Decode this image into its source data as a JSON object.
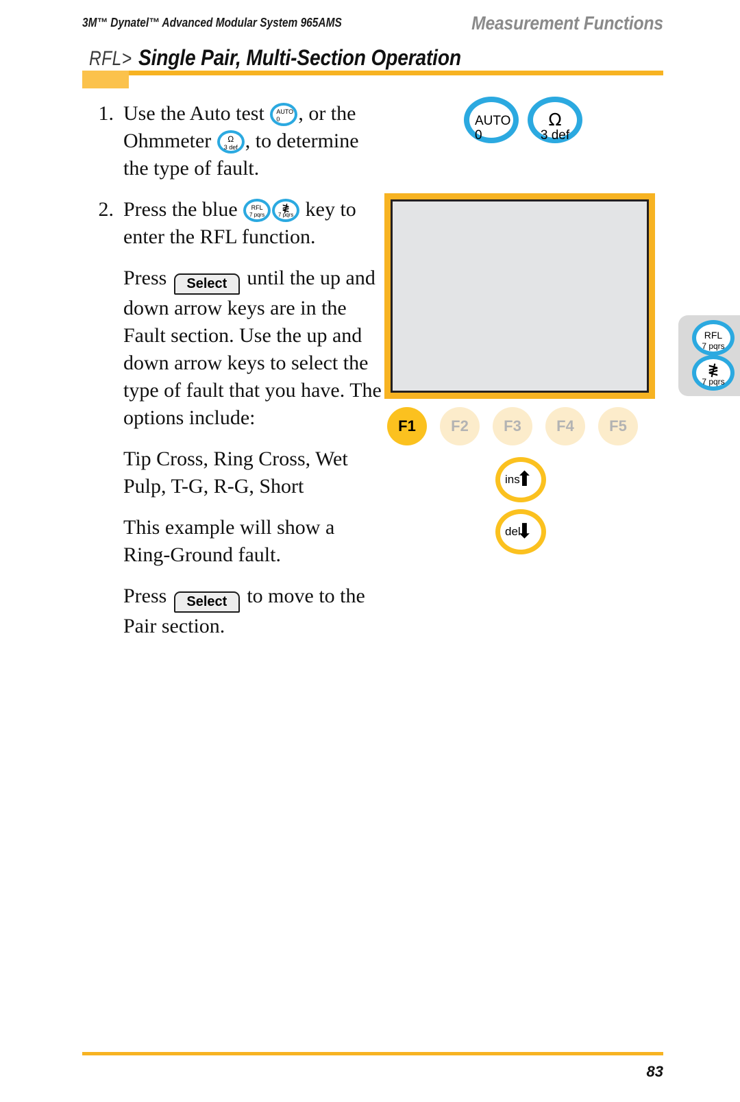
{
  "header": {
    "product": "3M™ Dynatel™ Advanced Modular System 965AMS",
    "section": "Measurement Functions"
  },
  "title": {
    "prefix": "RFL>",
    "main": "Single Pair, Multi-Section Operation"
  },
  "steps": [
    {
      "number": "1.",
      "text_before": "Use the Auto test ",
      "text_mid": ", or the Ohmmeter ",
      "text_after": ", to determine the type of fault."
    },
    {
      "number": "2.",
      "text_before": "Press the blue ",
      "text_after": " key to enter the RFL function."
    }
  ],
  "paragraphs": {
    "p1_before": "Press ",
    "p1_button": "Select",
    "p1_after": " until the up and down arrow keys are in the Fault section. Use the up and down arrow keys to select the type of fault that you have. The options include:",
    "p2": "Tip Cross, Ring Cross, Wet Pulp, T-G, R-G, Short",
    "p3": "This example will show a Ring-Ground fault.",
    "p4_before": "Press ",
    "p4_button": "Select",
    "p4_after": " to move to the Pair section."
  },
  "inline_keys": {
    "auto": {
      "top": "AUTO",
      "bottom": "0"
    },
    "ohm": {
      "top": "Ω",
      "bottom": "3 def"
    },
    "rfl": {
      "top": "RFL",
      "bottom": "7 pqrs"
    },
    "bolt": {
      "glyph": "≹",
      "bottom": "7 pqrs"
    }
  },
  "device": {
    "key_auto": {
      "top": "AUTO",
      "bottom": "0"
    },
    "key_ohm": {
      "top": "Ω",
      "bottom": "3 def"
    },
    "fkeys": [
      {
        "label": "F1",
        "active": true
      },
      {
        "label": "F2",
        "active": false
      },
      {
        "label": "F3",
        "active": false
      },
      {
        "label": "F4",
        "active": false
      },
      {
        "label": "F5",
        "active": false
      }
    ],
    "arrow_keys": [
      {
        "label": "ins",
        "glyph": "⬆"
      },
      {
        "label": "del",
        "glyph": "⬇"
      }
    ],
    "side_tab": {
      "key_rfl": {
        "top": "RFL",
        "bottom": "7 pqrs"
      },
      "key_bolt": {
        "glyph": "≹",
        "bottom": "7 pqrs"
      }
    },
    "lcd_content": ""
  },
  "footer": {
    "page_number": "83"
  },
  "colors": {
    "blue_key": "#2BA9E0",
    "gold": "#F7B322",
    "gold_active": "#FBC11F",
    "fkey_inactive": "#FCECCB",
    "lcd": "#E3E4E6",
    "tab_gray": "#D9D9D9"
  }
}
